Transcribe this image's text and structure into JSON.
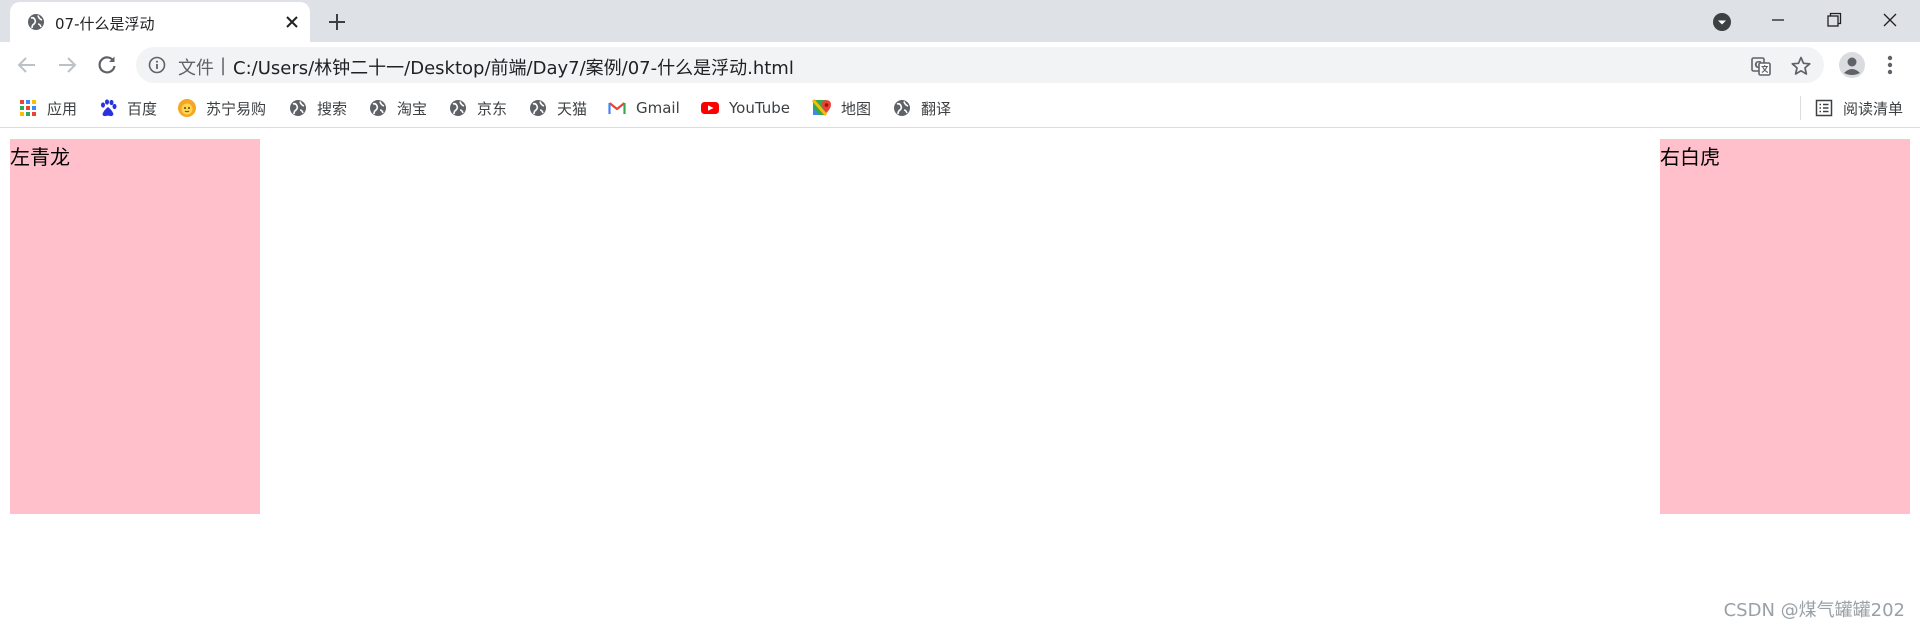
{
  "tab": {
    "title": "07-什么是浮动",
    "favicon": "globe-icon"
  },
  "address_bar": {
    "chip": "文件",
    "separator": "|",
    "url": "C:/Users/林钟二十一/Desktop/前端/Day7/案例/07-什么是浮动.html"
  },
  "bookmarks": {
    "items": [
      {
        "label": "应用",
        "icon": "apps-grid-icon"
      },
      {
        "label": "百度",
        "icon": "baidu-paw-icon"
      },
      {
        "label": "苏宁易购",
        "icon": "suning-lion-icon"
      },
      {
        "label": "搜索",
        "icon": "globe-icon"
      },
      {
        "label": "淘宝",
        "icon": "globe-icon"
      },
      {
        "label": "京东",
        "icon": "globe-icon"
      },
      {
        "label": "天猫",
        "icon": "globe-icon"
      },
      {
        "label": "Gmail",
        "icon": "gmail-icon"
      },
      {
        "label": "YouTube",
        "icon": "youtube-icon"
      },
      {
        "label": "地图",
        "icon": "maps-pin-icon"
      },
      {
        "label": "翻译",
        "icon": "globe-icon"
      }
    ],
    "reading_list": {
      "label": "阅读清单",
      "icon": "reading-list-icon"
    }
  },
  "content": {
    "left_box_text": "左青龙",
    "right_box_text": "右白虎",
    "box_color": "#ffc0cb"
  },
  "watermark": "CSDN @煤气罐罐202",
  "colors": {
    "tabstrip": "#dee1e6",
    "omnibox": "#f1f3f4",
    "icon": "#5f6368"
  }
}
